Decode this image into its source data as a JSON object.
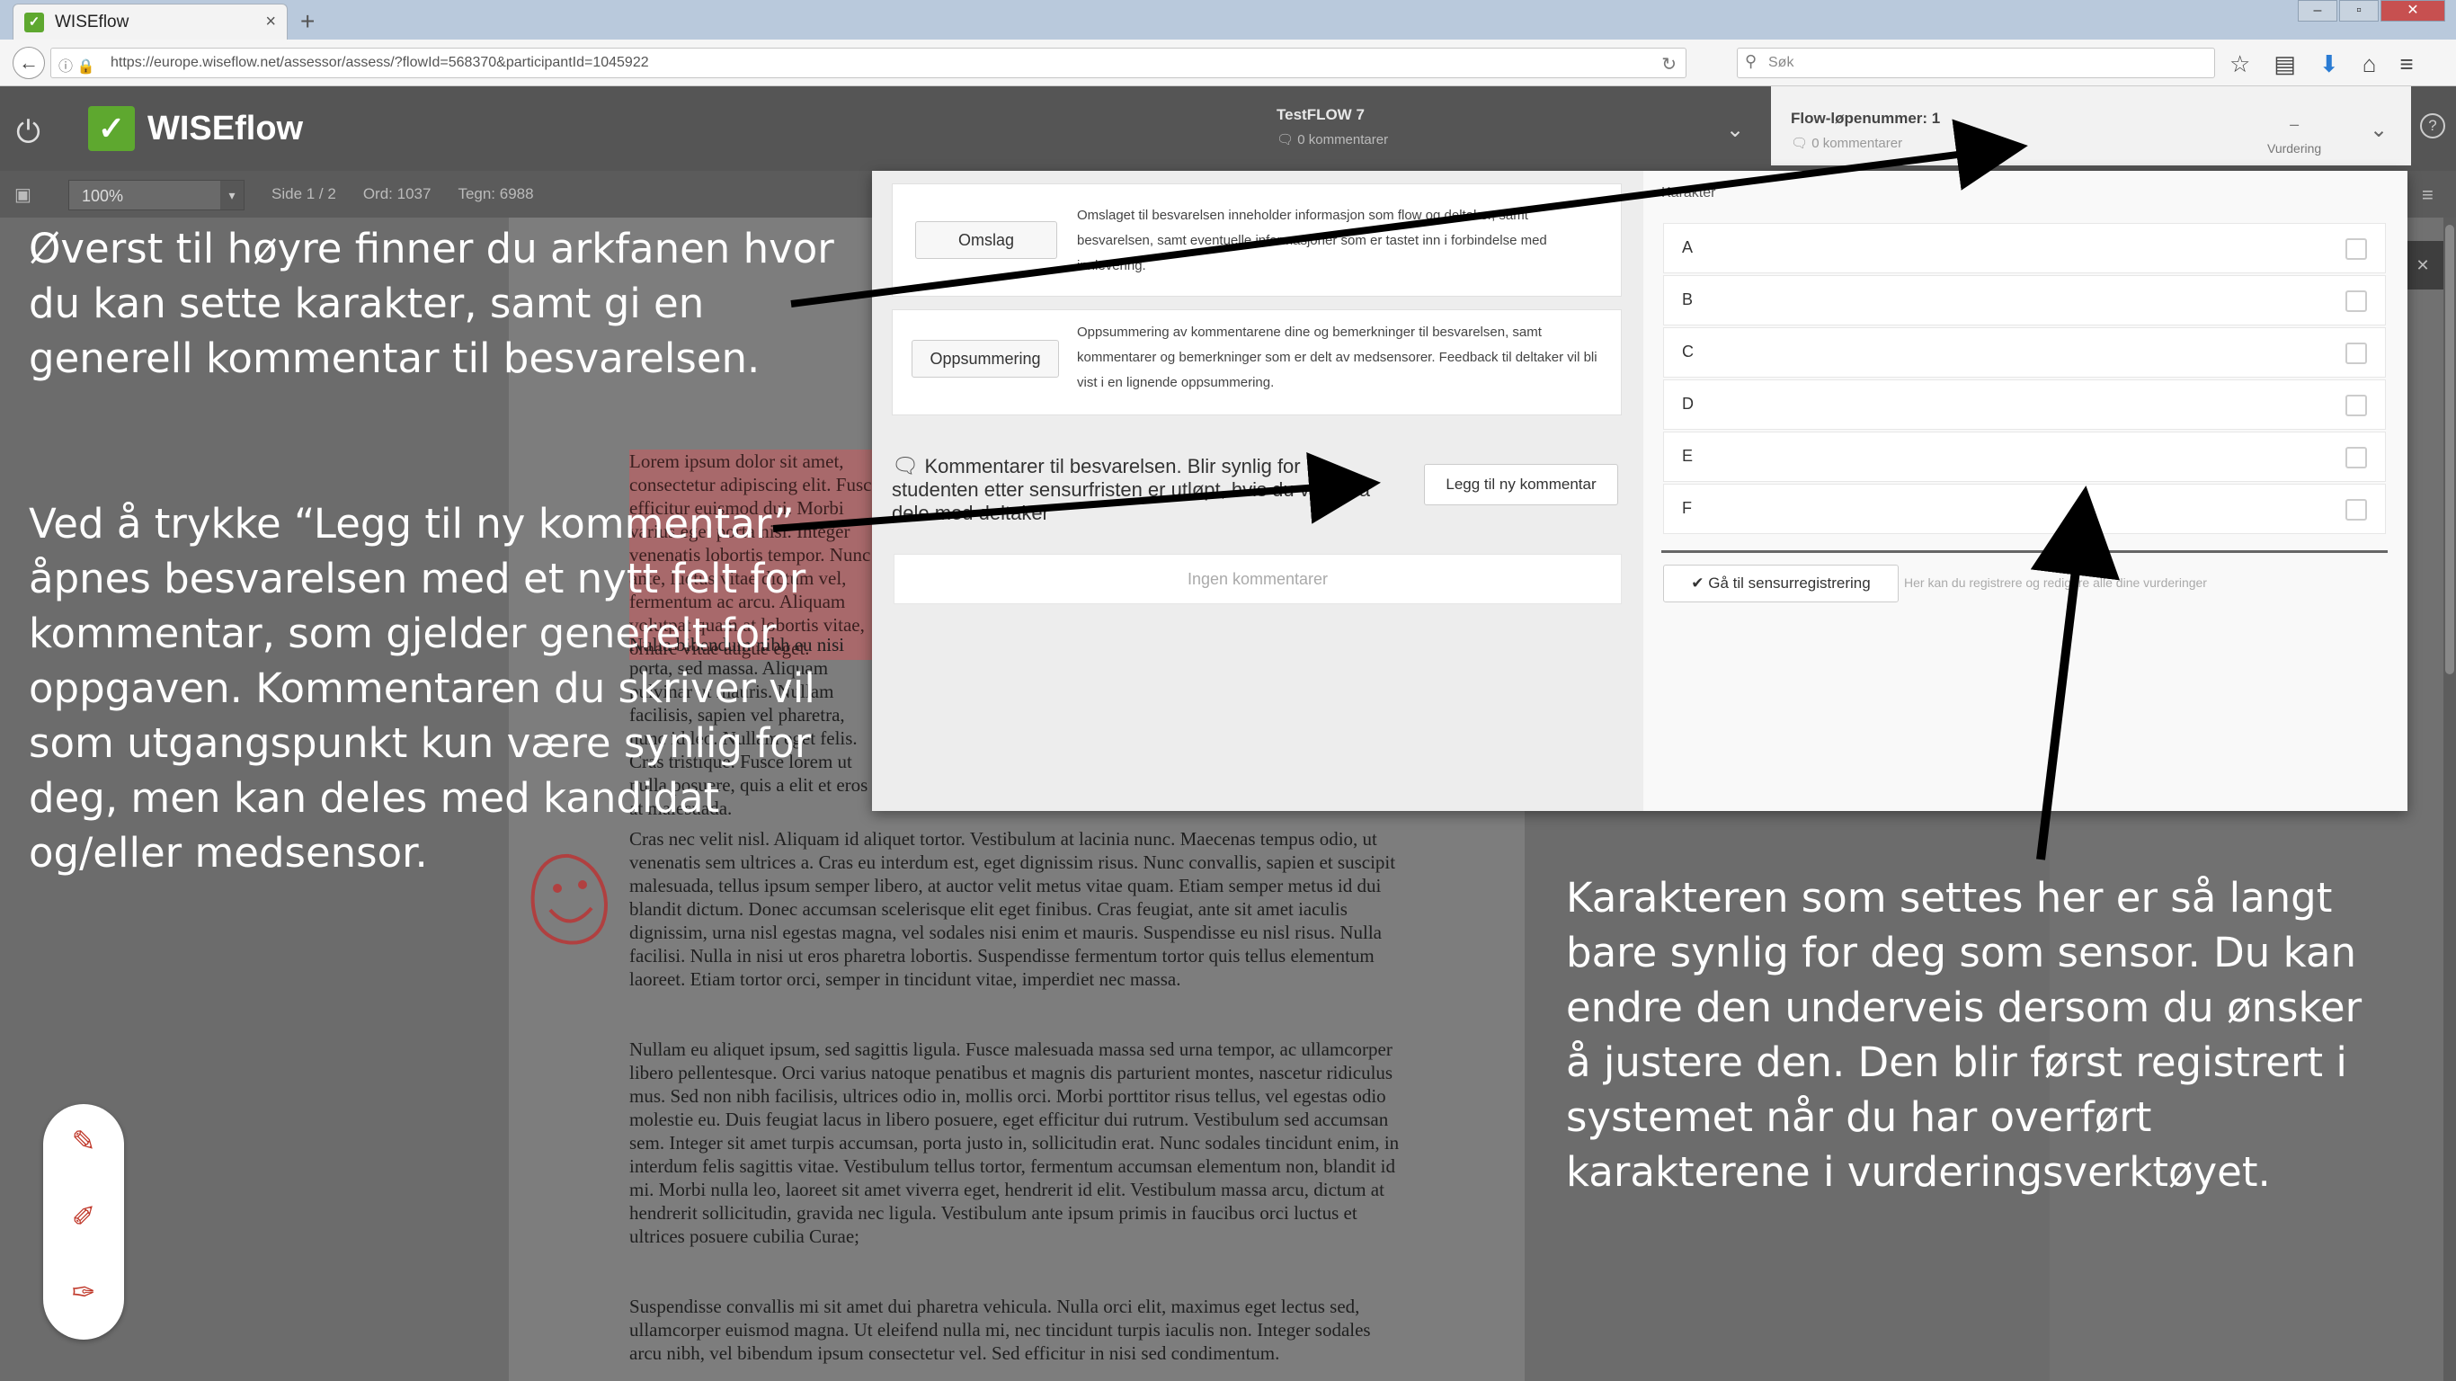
{
  "browser": {
    "tab_title": "WISEflow",
    "url": "https://europe.wiseflow.net/assessor/assess/?flowId=568370&participantId=1045922",
    "search_placeholder": "Søk"
  },
  "app": {
    "name": "WISEflow",
    "flow_title": "TestFLOW 7",
    "flow_comments": "0 kommentarer",
    "right_panel_title": "Flow-løpenummer: 1",
    "right_panel_comments": "0 kommentarer",
    "vurdering_value": "–",
    "vurdering_label": "Vurdering"
  },
  "toolbar": {
    "zoom": "100%",
    "page": "Side 1 / 2",
    "words": "Ord: 1037",
    "chars": "Tegn: 6988"
  },
  "panel": {
    "omslag_label": "Omslag",
    "omslag_desc": "Omslaget til besvarelsen inneholder informasjon som flow og deltaker, samt besvarelsen, samt eventuelle informasjoner som er tastet inn i forbindelse med innlevering.",
    "oppsummering_label": "Oppsummering",
    "oppsummering_desc": "Oppsummering av kommentarene dine og bemerkninger til besvarelsen, samt kommentarer og bemerkninger som er delt av medsensorer. Feedback til deltaker vil bli vist i en lignende oppsummering.",
    "comments_heading": "Kommentarer til besvarelsen. Blir synlig for studenten etter sensurfristen er utløpt, hvis du velger å dele med deltaker",
    "add_comment_label": "Legg til ny kommentar",
    "no_comments": "Ingen kommentarer",
    "grades_label": "Karakter",
    "grades": [
      "A",
      "B",
      "C",
      "D",
      "E",
      "F"
    ],
    "goto_label": "Gå til sensurregistrering",
    "goto_desc": "Her kan du registrere og redigere alle dine vurderinger"
  },
  "document": {
    "para1": "Lorem ipsum dolor sit amet, consectetur adipiscing elit. Fusce efficitur euismod dui. Morbi varius eget porta nisl. Integer venenatis lobortis tempor. Nunc ante, luctus vitae dictum vel, fermentum ac arcu. Aliquam volutpat quam at lobortis vitae, ornare vitae augue eget.",
    "para2": "Nulla bibendum nibh eu nisi porta, sed massa. Aliquam pulvinar ut mauris. Nullam facilisis, sapien vel pharetra, nunc id leo. Nullam eget felis. Cras tristique. Fusce lorem ut nulla posuere, quis a elit et eros at malesuada.",
    "para3": "Cras nec velit nisl. Aliquam id aliquet tortor. Vestibulum at lacinia nunc. Maecenas tempus odio, ut venenatis sem ultrices a. Cras eu interdum est, eget dignissim risus. Nunc convallis, sapien et suscipit malesuada, tellus ipsum semper libero, at auctor velit metus vitae quam. Etiam semper metus id dui blandit dictum. Donec accumsan scelerisque elit eget finibus. Cras feugiat, ante sit amet iaculis dignissim, urna nisl egestas magna, vel sodales nisi enim et mauris. Suspendisse eu nisl risus. Nulla facilisi. Nulla in nisi ut eros pharetra lobortis. Suspendisse fermentum tortor quis tellus elementum laoreet. Etiam tortor orci, semper in tincidunt vitae, imperdiet nec massa.",
    "para4": "Nullam eu aliquet ipsum, sed sagittis ligula. Fusce malesuada massa sed urna tempor, ac ullamcorper libero pellentesque. Orci varius natoque penatibus et magnis dis parturient montes, nascetur ridiculus mus. Sed non nibh facilisis, ultrices odio in, mollis orci. Morbi porttitor risus tellus, vel egestas odio molestie eu. Duis feugiat lacus in libero posuere, eget efficitur dui rutrum. Vestibulum sed accumsan sem. Integer sit amet turpis accumsan, porta justo in, sollicitudin erat. Nunc sodales tincidunt enim, in interdum felis sagittis vitae. Vestibulum tellus tortor, fermentum accumsan elementum non, blandit id mi. Morbi nulla leo, laoreet sit amet viverra eget, hendrerit id elit. Vestibulum massa arcu, dictum at hendrerit sollicitudin, gravida nec ligula. Vestibulum ante ipsum primis in faucibus orci luctus et ultrices posuere cubilia Curae;",
    "para5": "Suspendisse convallis mi sit amet dui pharetra vehicula. Nulla orci elit, maximus eget lectus sed, ullamcorper euismod magna. Ut eleifend nulla mi, nec tincidunt turpis iaculis non. Integer sodales arcu nibh, vel bibendum ipsum consectetur vel. Sed efficitur in nisi sed condimentum."
  },
  "annotations": {
    "top_left": "Øverst til høyre finner du arkfanen hvor du kan sette karakter, samt gi en generell kommentar til besvarelsen.",
    "middle_left": "Ved å trykke “Legg til ny kommentar” åpnes besvarelsen med et nytt felt for kommentar, som gjelder generelt for oppgaven. Kommentaren du skriver vil som utgangspunkt kun være synlig for deg, men kan deles med kandidat og/eller medsensor.",
    "bottom_right": "Karakteren som settes her er så langt bare synlig for deg som sensor. Du kan endre den underveis dersom du ønsker å justere den. Den blir først registrert i systemet når du har overført karakterene i vurderingsverktøyet."
  },
  "colors": {
    "brand_green": "#5ea82f",
    "header_gray": "#555555",
    "highlight_red": "#a8696b"
  }
}
